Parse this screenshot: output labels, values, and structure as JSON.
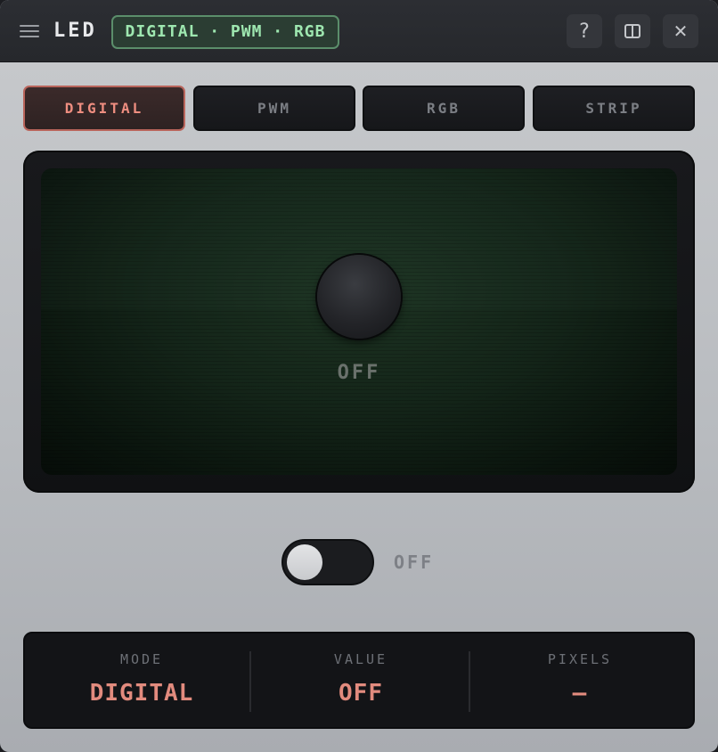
{
  "titlebar": {
    "title": "LED",
    "badge": "DIGITAL · PWM · RGB",
    "help_label": "?",
    "close_label": "✕"
  },
  "tabs": [
    {
      "label": "DIGITAL",
      "active": true
    },
    {
      "label": "PWM",
      "active": false
    },
    {
      "label": "RGB",
      "active": false
    },
    {
      "label": "STRIP",
      "active": false
    }
  ],
  "display": {
    "led_state": "OFF"
  },
  "toggle": {
    "on": false,
    "label": "OFF"
  },
  "status": [
    {
      "label": "MODE",
      "value": "DIGITAL"
    },
    {
      "label": "VALUE",
      "value": "OFF"
    },
    {
      "label": "PIXELS",
      "value": "—"
    }
  ],
  "colors": {
    "accent": "#e28b7e",
    "badge_text": "#9ee7b0",
    "screen_green": "#142519"
  }
}
